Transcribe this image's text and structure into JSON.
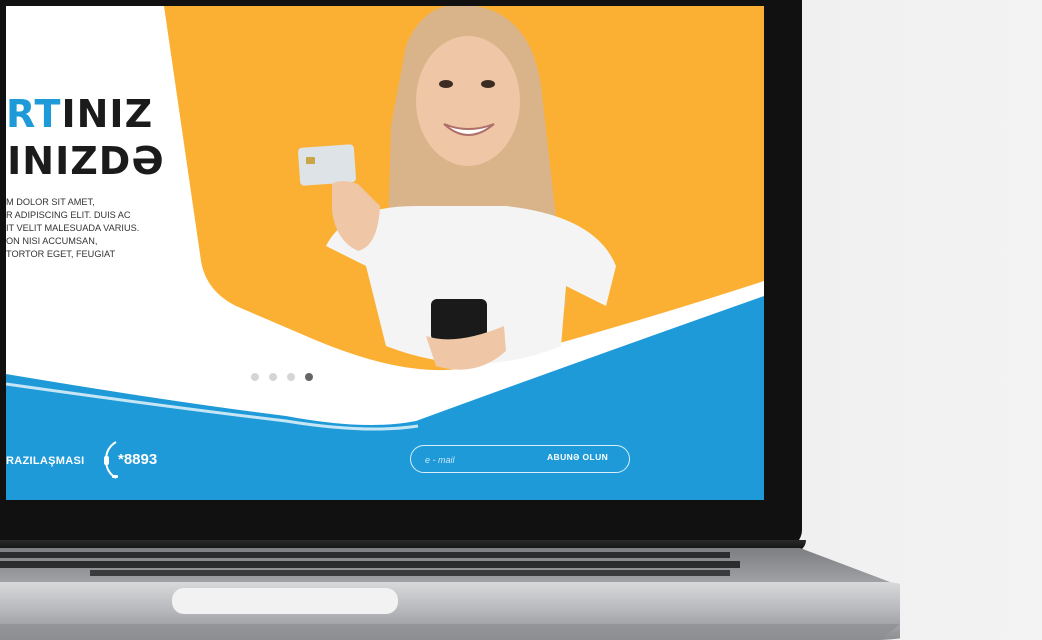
{
  "hero": {
    "headline_line1_accent": "RT",
    "headline_line1_rest": "INIZ",
    "headline_line2_accent": "İ",
    "headline_line2_rest": "INIZDƏ",
    "body_lines": [
      "M DOLOR SIT AMET,",
      "R ADIPISCING ELIT. DUIS AC",
      "IT VELIT MALESUADA VARIUS.",
      "ON NISI ACCUMSAN,",
      "TORTOR EGET, FEUGIAT"
    ],
    "slide_count": 4,
    "active_slide": 4
  },
  "footer": {
    "agreement_label": "RAZILAŞMASI",
    "phone_number": "*8893",
    "email_placeholder": "e - mail",
    "subscribe_label": "ABUNƏ OLUN"
  },
  "colors": {
    "accent_blue": "#1e9ad9",
    "hero_yellow": "#fbb034",
    "text_dark": "#1b1b1b"
  },
  "icons": {
    "phone": "headset-phone-icon"
  }
}
